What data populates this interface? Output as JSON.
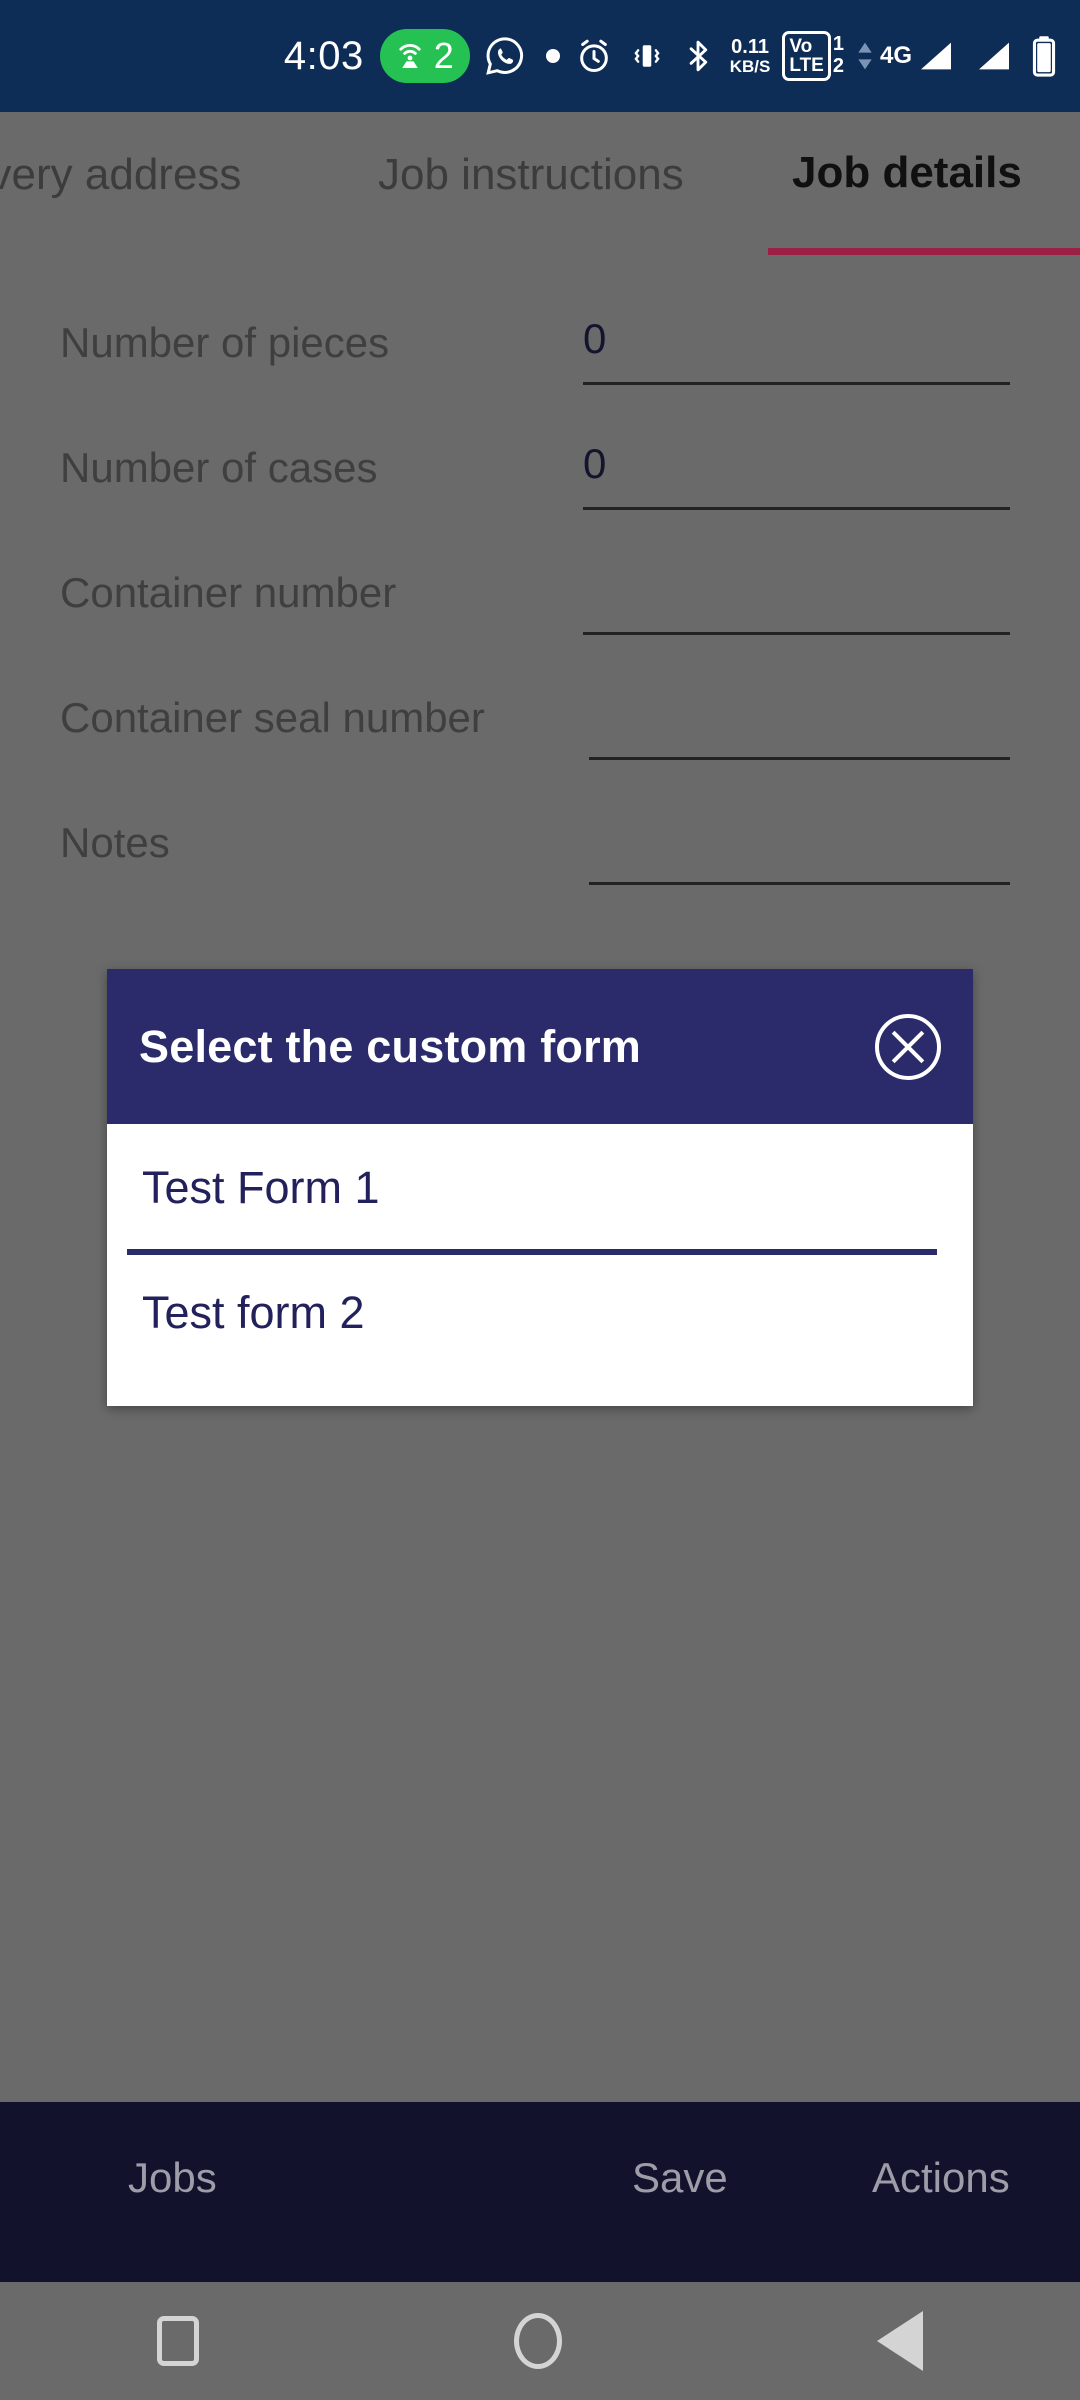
{
  "status_bar": {
    "time": "4:03",
    "hotspot_count": "2",
    "hotspot_icon": "wifi-hotspot-icon",
    "whatsapp_icon": "whatsapp-icon",
    "notification_dot_icon": "notification-dot-icon",
    "alarm_icon": "alarm-clock-icon",
    "vibrate_icon": "vibrate-icon",
    "bluetooth_icon": "bluetooth-icon",
    "data_rate": "0.11",
    "data_rate_unit": "KB/S",
    "volte_line1": "Vo",
    "volte_line2": "LTE",
    "volte_sim1": "1",
    "volte_sim2": "2",
    "network_type": "4G",
    "data_arrows_icon": "data-transfer-arrows-icon",
    "signal1_icon": "signal-bars-sim1-icon",
    "signal2_icon": "signal-bars-sim2-icon",
    "battery_icon": "battery-icon",
    "background_color": "#0d2d57"
  },
  "tabs": {
    "items": [
      {
        "label": "livery address",
        "active": false
      },
      {
        "label": "Job instructions",
        "active": false
      },
      {
        "label": "Job details",
        "active": true
      }
    ],
    "active_indicator_color": "#9c1f45"
  },
  "form": {
    "fields": [
      {
        "label": "Number of pieces",
        "value": "0"
      },
      {
        "label": "Number of cases",
        "value": "0"
      },
      {
        "label": "Container number",
        "value": ""
      },
      {
        "label": "Container seal number",
        "value": ""
      },
      {
        "label": "Notes",
        "value": ""
      }
    ]
  },
  "dialog": {
    "title": "Select the custom form",
    "close_icon": "close-circle-icon",
    "header_color": "#2b2a6b",
    "options": [
      {
        "label": "Test Form 1"
      },
      {
        "label": "Test form 2"
      }
    ]
  },
  "action_bar": {
    "jobs": "Jobs",
    "save": "Save",
    "actions": "Actions",
    "background_color": "#12122c"
  },
  "nav_bar": {
    "recents_icon": "square-recents-icon",
    "home_icon": "circle-home-icon",
    "back_icon": "triangle-back-icon"
  }
}
